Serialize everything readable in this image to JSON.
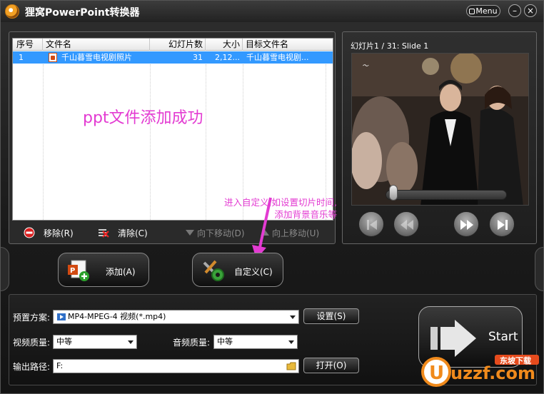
{
  "window": {
    "title": "狸窝PowerPoint转换器",
    "menu_label": "Menu",
    "minimize_label": "–",
    "close_label": "×"
  },
  "file_list": {
    "columns": [
      "序号",
      "文件名",
      "幻灯片数",
      "大小",
      "目标文件名"
    ],
    "rows": [
      {
        "index": "1",
        "file_name": "千山暮雪电视剧照片",
        "slides": "31",
        "size": "2,12...",
        "target_name": "千山暮雪电视剧..."
      }
    ],
    "annotation_success": "ppt文件添加成功",
    "annotation_hint_line1": "进入自定义,如设置切片时间,",
    "annotation_hint_line2": "添加背景音乐等",
    "actions": {
      "remove": "移除(R)",
      "clear": "清除(C)",
      "move_down": "向下移动(D)",
      "move_up": "向上移动(U)"
    }
  },
  "preview": {
    "slide_label": "幻灯片1 / 31: Slide 1",
    "slide_position": 0.03
  },
  "buttons": {
    "add": "添加(A)",
    "customize": "自定义(C)"
  },
  "settings": {
    "preset_label": "预置方案:",
    "preset_value": "MP4-MPEG-4 视频(*.mp4)",
    "settings_button": "设置(S)",
    "video_quality_label": "视频质量:",
    "video_quality_value": "中等",
    "audio_quality_label": "音频质量:",
    "audio_quality_value": "中等",
    "output_path_label": "输出路径:",
    "output_path_value": "F:",
    "open_button": "打开(O)",
    "start_label": "Start"
  },
  "watermark": {
    "text_top": "东坡下载",
    "text_main": "uzzf.com"
  },
  "colors": {
    "annotation": "#e33bd2",
    "selection": "#3399ff",
    "background": "#1c1c1c"
  }
}
